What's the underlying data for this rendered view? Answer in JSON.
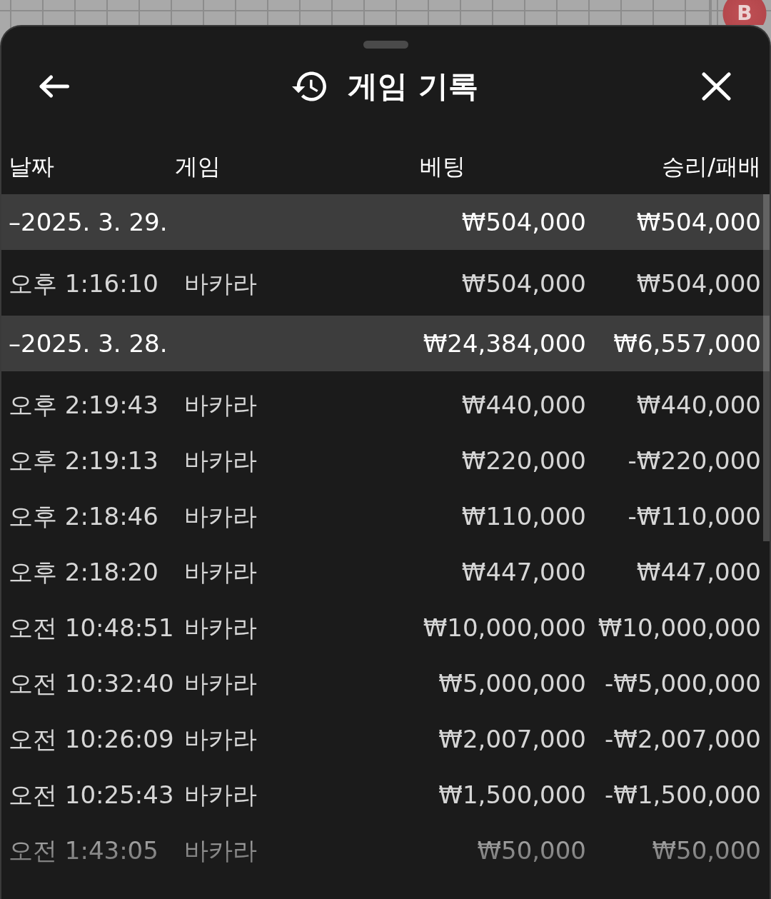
{
  "background": {
    "marker": "B"
  },
  "sheet": {
    "title": "게임 기록"
  },
  "table": {
    "columns": [
      "날짜",
      "게임",
      "베팅",
      "승리/패배"
    ],
    "groups": [
      {
        "date": "–2025. 3. 29.",
        "bet": "₩504,000",
        "result": "₩504,000",
        "rows": [
          {
            "time": "오후 1:16:10",
            "game": "바카라",
            "bet": "₩504,000",
            "result": "₩504,000"
          }
        ]
      },
      {
        "date": "–2025. 3. 28.",
        "bet": "₩24,384,000",
        "result": "₩6,557,000",
        "rows": [
          {
            "time": "오후 2:19:43",
            "game": "바카라",
            "bet": "₩440,000",
            "result": "₩440,000"
          },
          {
            "time": "오후 2:19:13",
            "game": "바카라",
            "bet": "₩220,000",
            "result": "-₩220,000"
          },
          {
            "time": "오후 2:18:46",
            "game": "바카라",
            "bet": "₩110,000",
            "result": "-₩110,000"
          },
          {
            "time": "오후 2:18:20",
            "game": "바카라",
            "bet": "₩447,000",
            "result": "₩447,000"
          },
          {
            "time": "오전 10:48:51",
            "game": "바카라",
            "bet": "₩10,000,000",
            "result": "₩10,000,000"
          },
          {
            "time": "오전 10:32:40",
            "game": "바카라",
            "bet": "₩5,000,000",
            "result": "-₩5,000,000"
          },
          {
            "time": "오전 10:26:09",
            "game": "바카라",
            "bet": "₩2,007,000",
            "result": "-₩2,007,000"
          },
          {
            "time": "오전 10:25:43",
            "game": "바카라",
            "bet": "₩1,500,000",
            "result": "-₩1,500,000"
          },
          {
            "time": "오전 1:43:05",
            "game": "바카라",
            "bet": "₩50,000",
            "result": "₩50,000"
          }
        ]
      }
    ]
  }
}
